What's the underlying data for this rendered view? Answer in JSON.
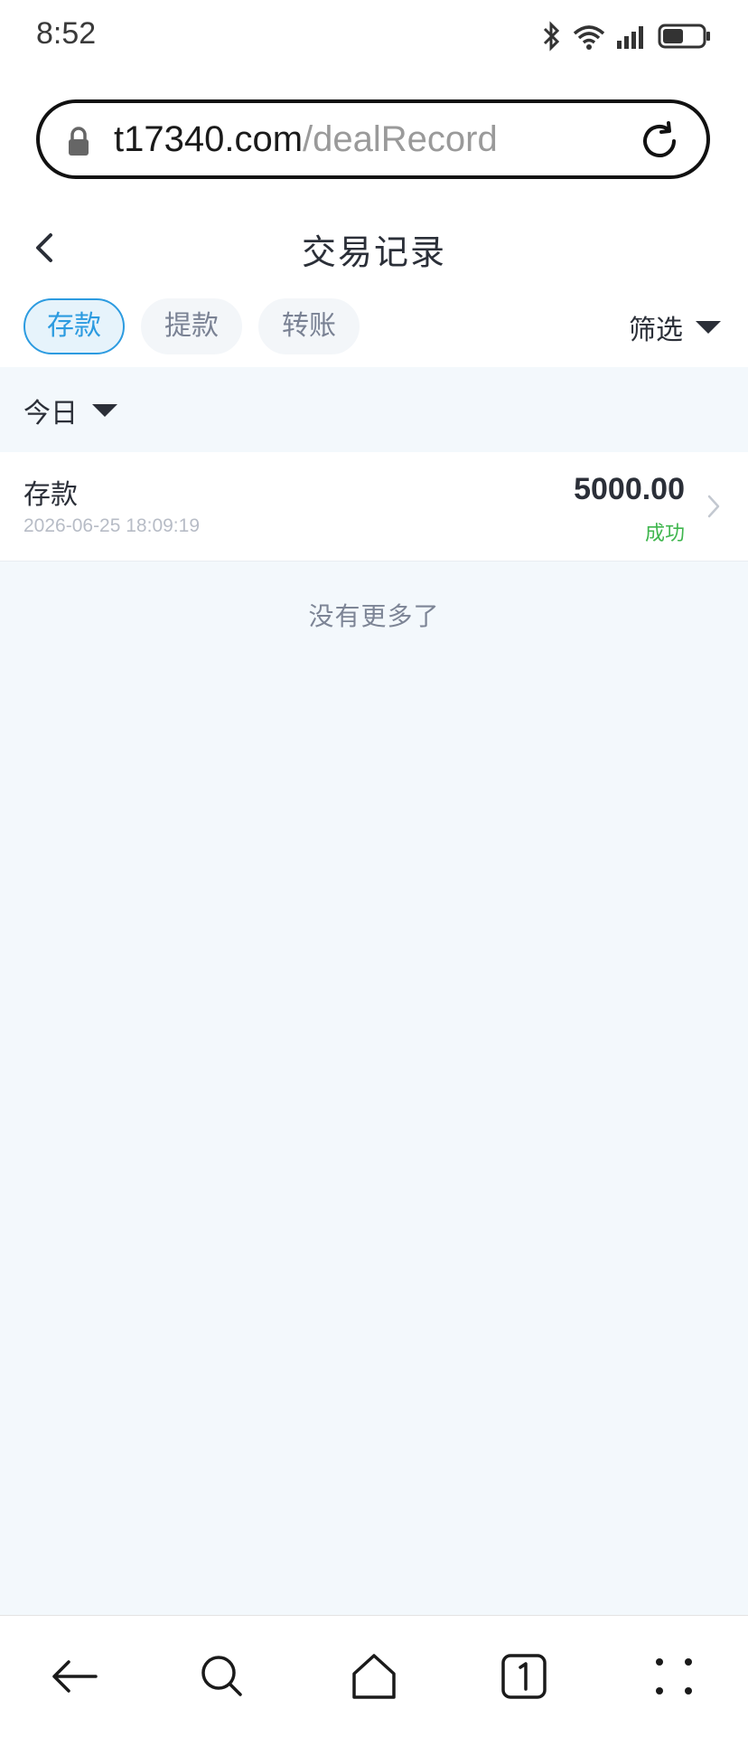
{
  "status_bar": {
    "time": "8:52",
    "icons": [
      "bluetooth-icon",
      "wifi-icon",
      "signal-icon",
      "battery-icon"
    ]
  },
  "address_bar": {
    "url_host": "t17340.com",
    "url_path": "/dealRecord"
  },
  "header": {
    "title": "交易记录"
  },
  "tabs": [
    {
      "label": "存款",
      "active": true
    },
    {
      "label": "提款",
      "active": false
    },
    {
      "label": "转账",
      "active": false
    }
  ],
  "filter": {
    "label": "筛选"
  },
  "date_filter": {
    "label": "今日"
  },
  "records": [
    {
      "type": "存款",
      "time": "2026-06-25 18:09:19",
      "amount": "5000.00",
      "status": "成功"
    }
  ],
  "list_end_text": "没有更多了",
  "colors": {
    "accent": "#2c9be0",
    "success": "#3fb64e",
    "page_bg": "#f3f8fc"
  }
}
